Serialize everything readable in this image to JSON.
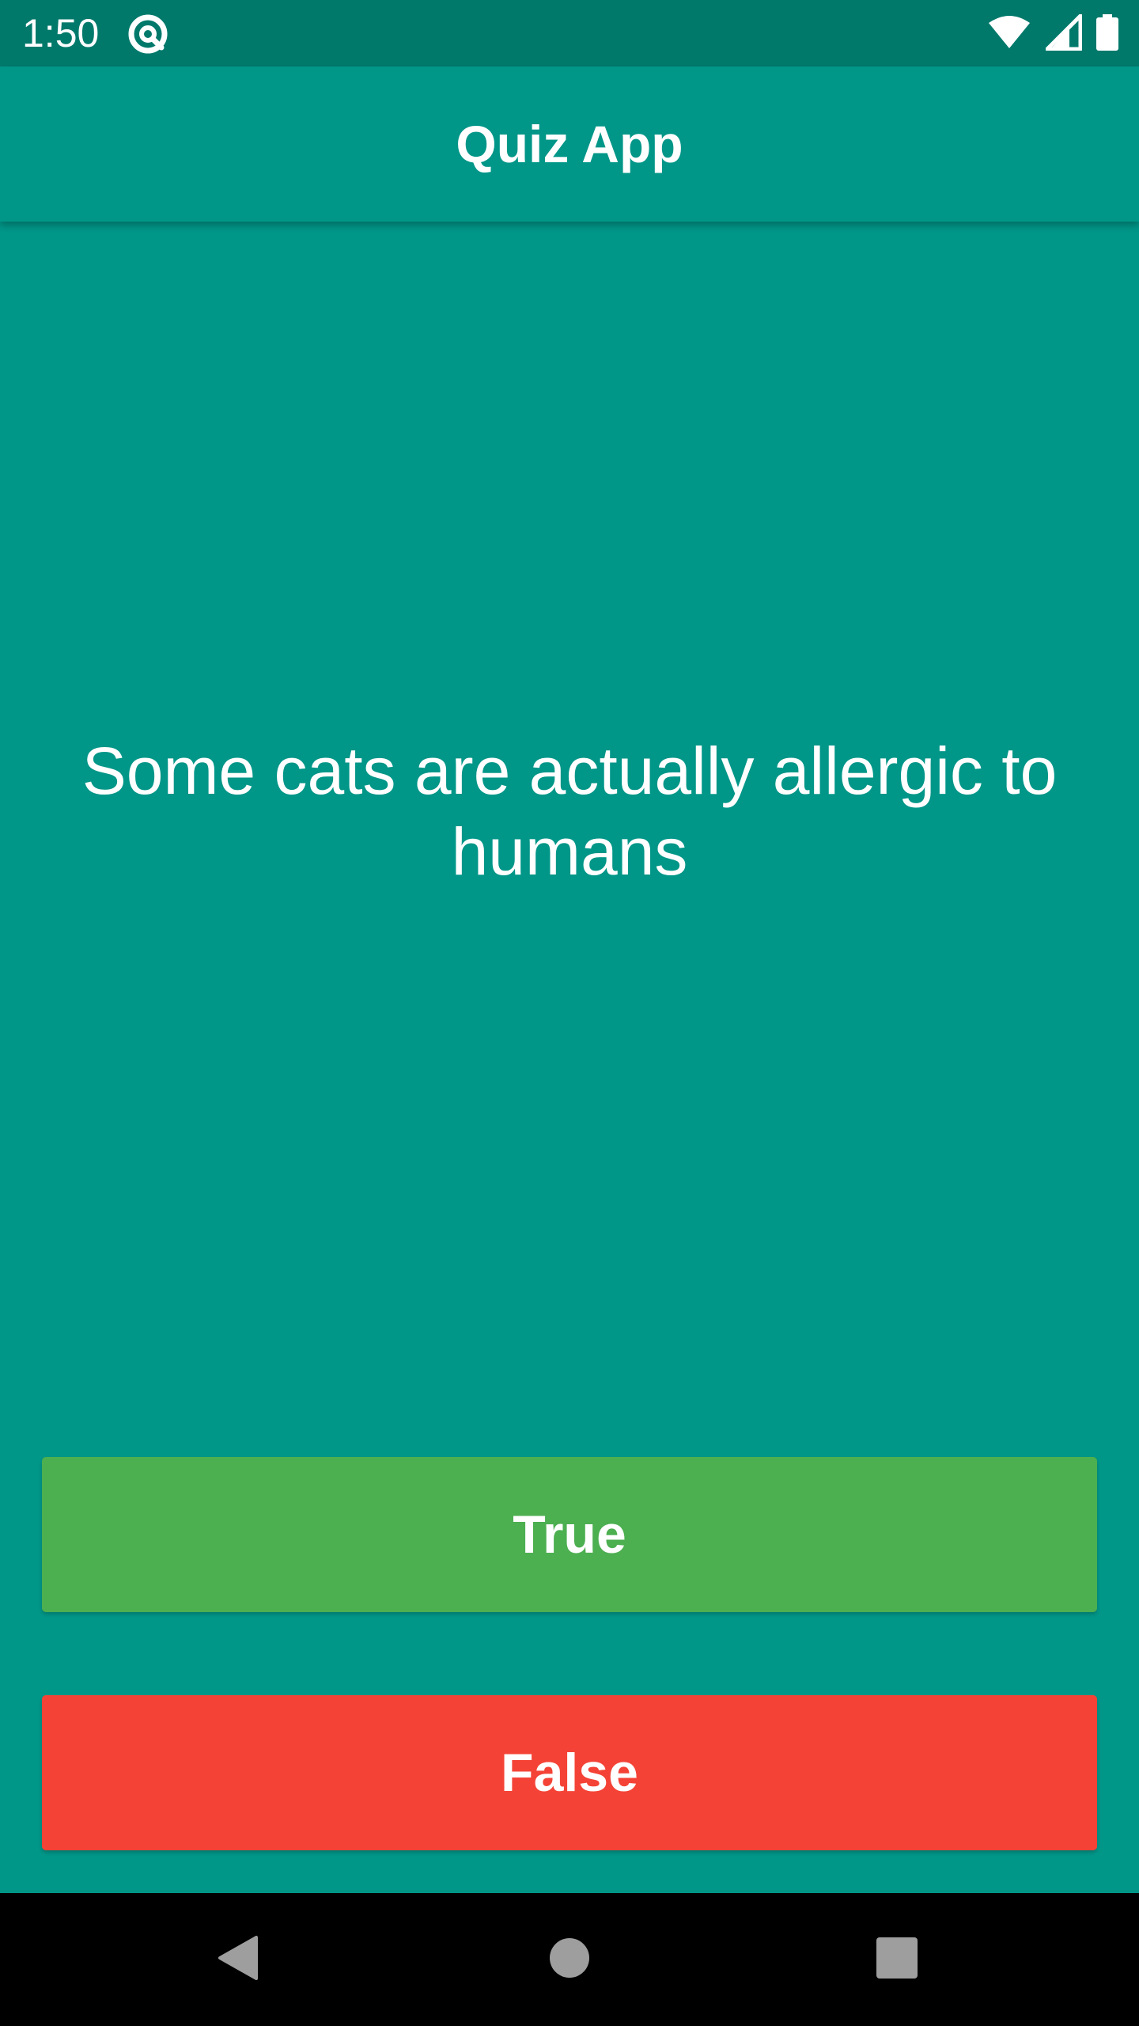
{
  "status_bar": {
    "time": "1:50",
    "icons": [
      "app-notification-icon",
      "wifi-icon",
      "cellular-signal-icon",
      "battery-icon"
    ]
  },
  "app_bar": {
    "title": "Quiz App"
  },
  "question": {
    "text": "Some cats are actually allergic to humans"
  },
  "answers": {
    "true_label": "True",
    "false_label": "False"
  },
  "navigation": {
    "icons": [
      "back-icon",
      "home-icon",
      "recents-icon"
    ]
  },
  "colors": {
    "status_bar": "#00796B",
    "primary": "#009688",
    "true_button": "#4CAF50",
    "false_button": "#F44336",
    "nav_bar": "#000000",
    "text": "#FFFFFF"
  }
}
